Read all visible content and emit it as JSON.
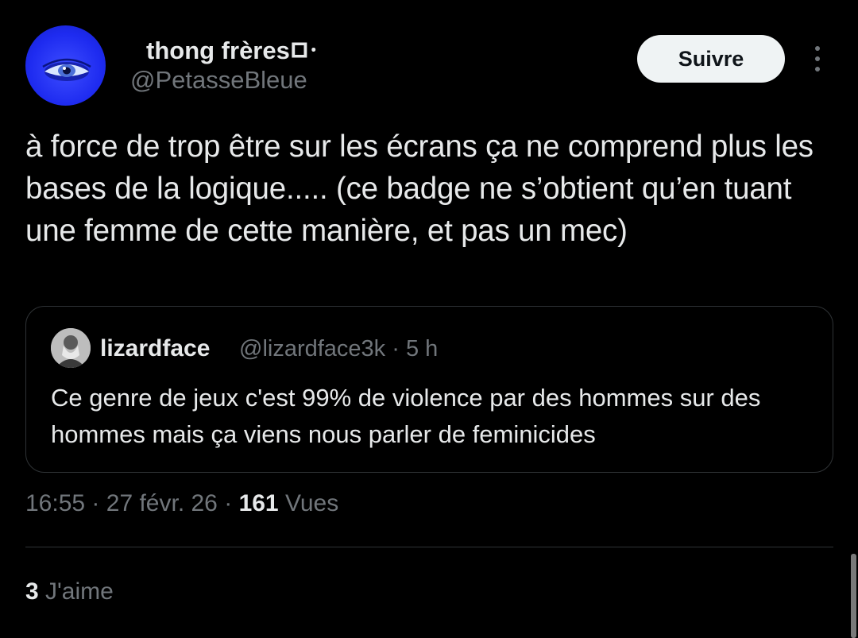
{
  "author": {
    "display_name": "thong frères𑀩𑁦",
    "handle": "@PetasseBleue",
    "avatar_icon": "blue-eye-avatar"
  },
  "actions": {
    "follow_label": "Suivre",
    "more_icon": "more-vertical-icon"
  },
  "tweet": {
    "text": "à force de trop être sur les écrans ça ne comprend plus les bases de la logique..... (ce badge ne s’obtient qu’en tuant une femme de cette manière, et pas un mec)"
  },
  "quote": {
    "display_name": "lizardface",
    "handle": "@lizardface3k",
    "separator": "·",
    "time": "5 h",
    "text": "Ce genre de jeux c'est 99% de violence par des hommes sur des hommes mais ça viens nous parler de feminicides"
  },
  "meta": {
    "time": "16:55",
    "separator": "·",
    "date": "27 févr. 26",
    "views_count": "161",
    "views_label": "Vues"
  },
  "likes": {
    "count": "3",
    "label": "J'aime"
  },
  "colors": {
    "background": "#000000",
    "text_primary": "#e7e9ea",
    "text_secondary": "#71767b",
    "border": "#2f3336",
    "button_bg": "#eff3f4",
    "avatar_blue": "#1e2bf0"
  }
}
